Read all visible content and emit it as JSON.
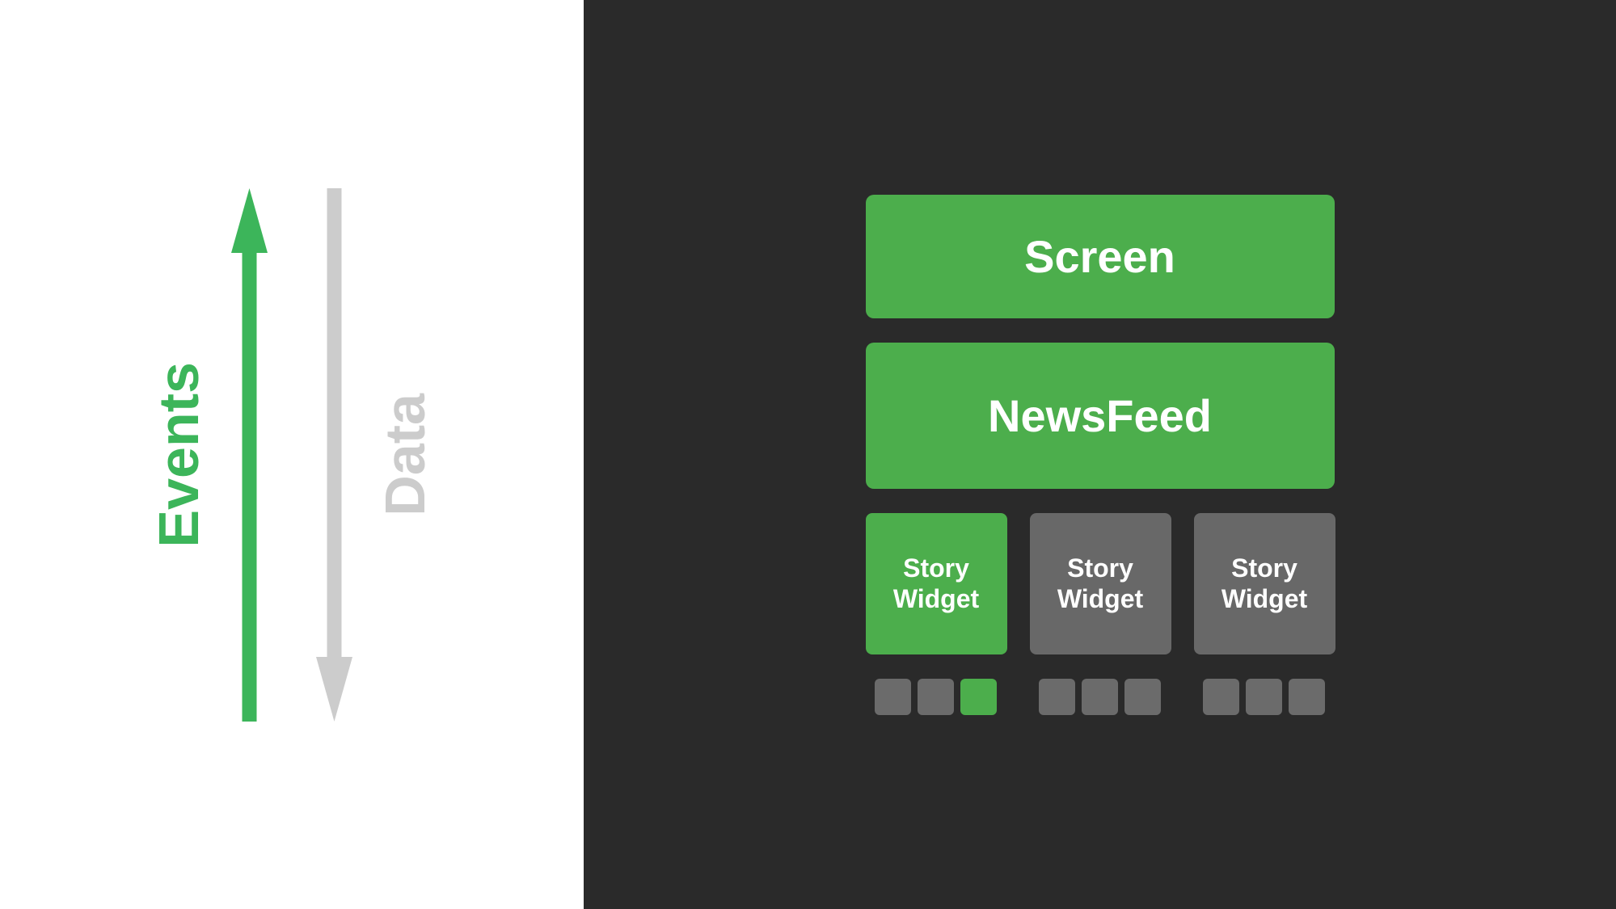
{
  "left": {
    "events_label": "Events",
    "data_label": "Data",
    "events_color": "#3cb55a",
    "data_color": "#cccccc"
  },
  "right": {
    "background_color": "#2a2a2a",
    "screen": {
      "label": "Screen",
      "bg_color": "#4cae4c"
    },
    "newsfeed": {
      "label": "NewsFeed",
      "bg_color": "#4cae4c"
    },
    "story_widgets": [
      {
        "label": "Story\nWidget",
        "type": "green",
        "bg_color": "#4cae4c",
        "indicators": [
          "gray",
          "gray",
          "green"
        ]
      },
      {
        "label": "Story\nWidget",
        "type": "gray",
        "bg_color": "#6b6b6b",
        "indicators": [
          "gray",
          "gray",
          "gray"
        ]
      },
      {
        "label": "Story\nWidget",
        "type": "gray",
        "bg_color": "#6b6b6b",
        "indicators": [
          "gray",
          "gray",
          "gray"
        ]
      }
    ]
  }
}
